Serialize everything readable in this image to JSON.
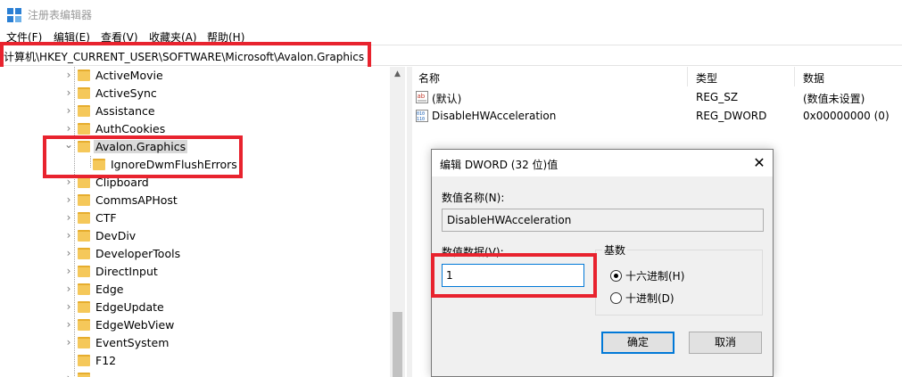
{
  "window": {
    "title": "注册表编辑器",
    "icon": "regedit-icon"
  },
  "menu": [
    "文件(F)",
    "编辑(E)",
    "查看(V)",
    "收藏夹(A)",
    "帮助(H)"
  ],
  "address": "计算机\\HKEY_CURRENT_USER\\SOFTWARE\\Microsoft\\Avalon.Graphics",
  "tree": {
    "items": [
      {
        "label": "ActiveMovie",
        "expanded": false
      },
      {
        "label": "ActiveSync",
        "expanded": false
      },
      {
        "label": "Assistance",
        "expanded": false
      },
      {
        "label": "AuthCookies",
        "expanded": false
      },
      {
        "label": "Avalon.Graphics",
        "expanded": true,
        "selected": true
      },
      {
        "label": "IgnoreDwmFlushErrors",
        "child": true
      },
      {
        "label": "Clipboard",
        "expanded": false
      },
      {
        "label": "CommsAPHost",
        "expanded": false
      },
      {
        "label": "CTF",
        "expanded": false
      },
      {
        "label": "DevDiv",
        "expanded": false
      },
      {
        "label": "DeveloperTools",
        "expanded": false
      },
      {
        "label": "DirectInput",
        "expanded": false
      },
      {
        "label": "Edge",
        "expanded": false
      },
      {
        "label": "EdgeUpdate",
        "expanded": false
      },
      {
        "label": "EdgeWebView",
        "expanded": false
      },
      {
        "label": "EventSystem",
        "expanded": false
      },
      {
        "label": "F12",
        "expanded": false
      }
    ]
  },
  "values_pane": {
    "headers": {
      "name": "名称",
      "type": "类型",
      "data": "数据"
    },
    "rows": [
      {
        "icon": "string-value-icon",
        "name": "(默认)",
        "type": "REG_SZ",
        "data": "(数值未设置)"
      },
      {
        "icon": "binary-value-icon",
        "name": "DisableHWAcceleration",
        "type": "REG_DWORD",
        "data": "0x00000000 (0)"
      }
    ]
  },
  "dialog": {
    "title": "编辑 DWORD (32 位)值",
    "name_label": "数值名称(N):",
    "name_value": "DisableHWAcceleration",
    "data_label": "数值数据(V):",
    "data_value": "1",
    "base_label": "基数",
    "radio_hex": "十六进制(H)",
    "radio_dec": "十进制(D)",
    "ok": "确定",
    "cancel": "取消",
    "base_selected": "hex"
  },
  "colors": {
    "highlight": "#e8232e",
    "folder": "#f5c85a",
    "focus": "#0078d7"
  }
}
